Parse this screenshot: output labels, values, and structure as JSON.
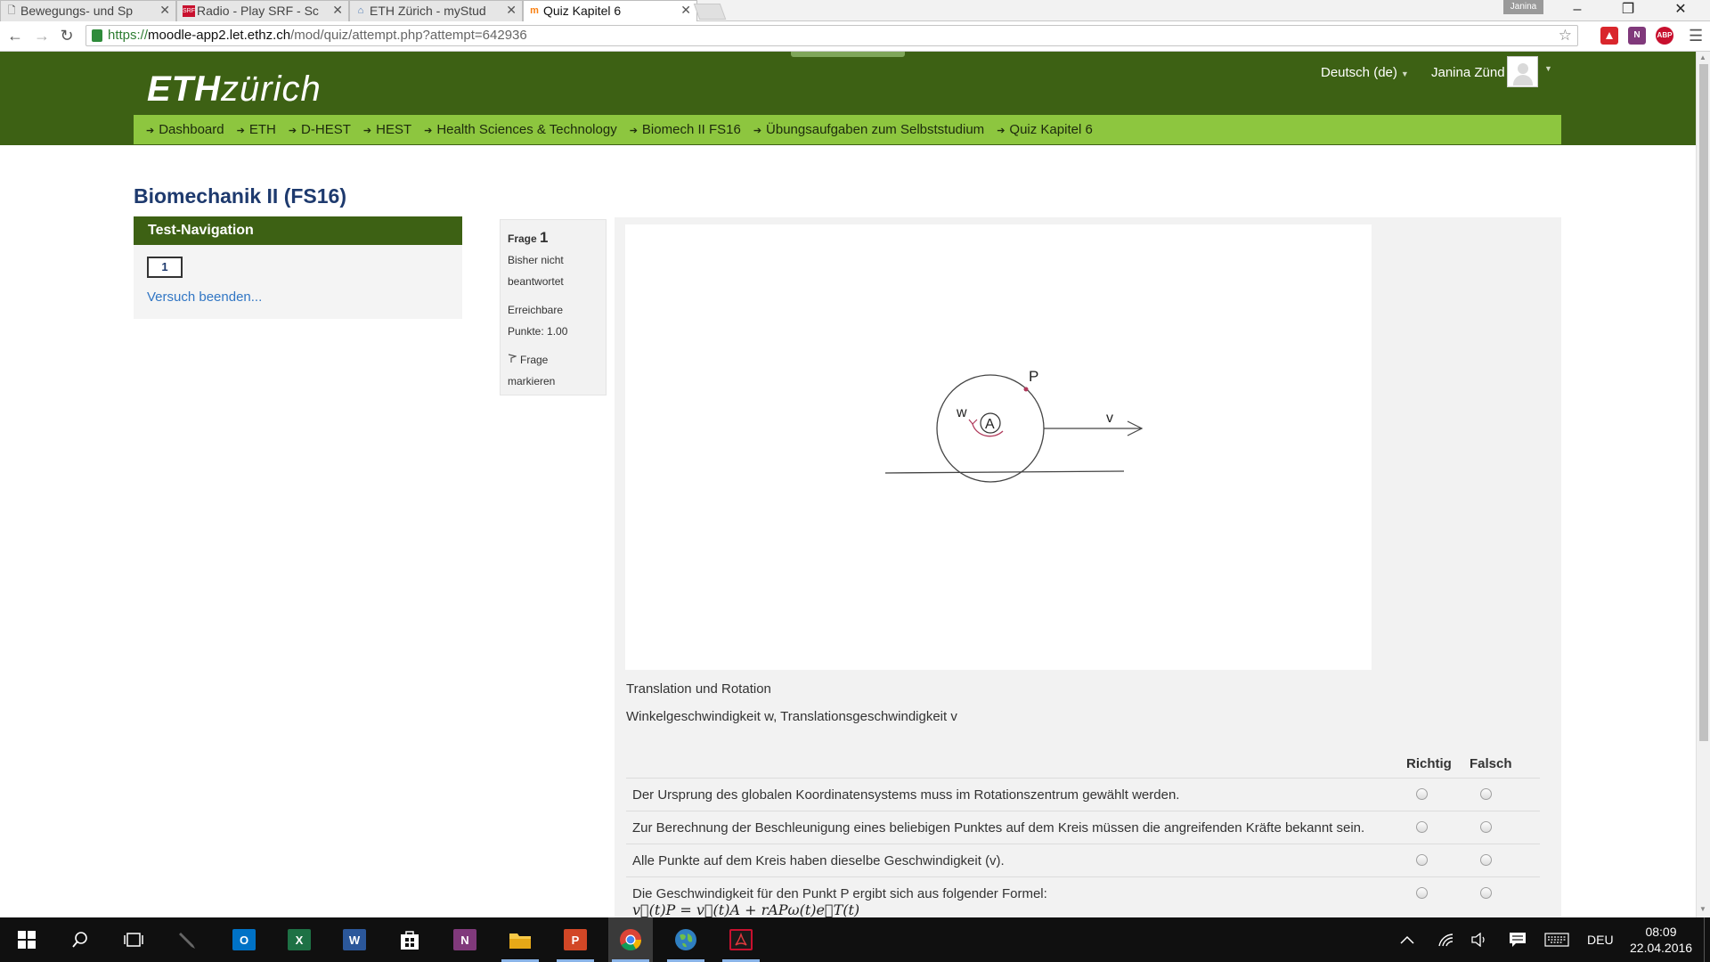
{
  "browser": {
    "tabs": [
      {
        "title": "Bewegungs- und Sp",
        "icon": "document-icon",
        "active": false
      },
      {
        "title": "Radio - Play SRF - Sc",
        "icon": "srf-icon",
        "active": false
      },
      {
        "title": "ETH Zürich - myStud",
        "icon": "house-icon",
        "active": false
      },
      {
        "title": "Quiz Kapitel 6",
        "icon": "moodle-icon",
        "active": true
      }
    ],
    "profile_name": "Janina",
    "url_scheme": "https://",
    "url_host": "moodle-app2.let.ethz.ch",
    "url_path": "/mod/quiz/attempt.php?attempt=642936",
    "extensions": [
      {
        "label": "",
        "color": "#d9262c"
      },
      {
        "label": "N",
        "color": "#80397b"
      },
      {
        "label": "ABP",
        "color": "#c8102e"
      }
    ]
  },
  "site": {
    "logo_bold": "ETH",
    "logo_light": "zürich",
    "language": "Deutsch (de)",
    "user_name": "Janina Zünd",
    "header_color": "#3d6114",
    "breadcrumb_color": "#8dc63f",
    "breadcrumbs": [
      "Dashboard",
      "ETH",
      "D-HEST",
      "HEST",
      "Health Sciences & Technology",
      "Biomech II FS16",
      "Übungsaufgaben zum Selbststudium",
      "Quiz Kapitel 6"
    ]
  },
  "course_title": "Biomechanik II (FS16)",
  "quiz_nav": {
    "heading": "Test-Navigation",
    "question_buttons": [
      "1"
    ],
    "finish_link": "Versuch beenden..."
  },
  "question_info": {
    "label": "Frage",
    "number": "1",
    "state_line1": "Bisher nicht",
    "state_line2": "beantwortet",
    "points_line1": "Erreichbare",
    "points_line2": "Punkte: 1.00",
    "flag_line1": "Frage",
    "flag_line2": "markieren"
  },
  "figure": {
    "label_p": "P",
    "label_w": "w",
    "label_a": "A",
    "label_v": "v"
  },
  "question": {
    "text1": "Translation und Rotation",
    "text2": "Winkelgeschwindigkeit w, Translationsgeschwindigkeit v",
    "col_true": "Richtig",
    "col_false": "Falsch",
    "statements": [
      {
        "text": "Der Ursprung des globalen Koordinatensystems muss im Rotationszentrum gewählt werden.",
        "formula": ""
      },
      {
        "text": "Zur Berechnung der Beschleunigung eines beliebigen Punktes auf dem Kreis müssen die angreifenden Kräfte bekannt sein.",
        "formula": ""
      },
      {
        "text": "Alle Punkte auf dem Kreis haben dieselbe Geschwindigkeit (v).",
        "formula": ""
      },
      {
        "text": "Die Geschwindigkeit für den Punkt P ergibt sich aus folgender Formel:",
        "formula": "v⃗(t)P = v⃗(t)A + rAPω(t)e⃗T(t)"
      }
    ]
  },
  "taskbar": {
    "apps": [
      {
        "name": "start-icon"
      },
      {
        "name": "search-icon"
      },
      {
        "name": "task-view-icon"
      },
      {
        "name": "pen-icon"
      },
      {
        "name": "outlook-icon",
        "label": "O",
        "color": "#0072c6"
      },
      {
        "name": "excel-icon",
        "label": "X",
        "color": "#1e7145"
      },
      {
        "name": "word-icon",
        "label": "W",
        "color": "#2b579a"
      },
      {
        "name": "store-icon"
      },
      {
        "name": "onenote-icon",
        "label": "N",
        "color": "#80397b"
      },
      {
        "name": "explorer-icon"
      },
      {
        "name": "powerpoint-icon",
        "label": "P",
        "color": "#d24726"
      },
      {
        "name": "chrome-icon"
      },
      {
        "name": "globe-icon"
      },
      {
        "name": "acrobat-icon"
      }
    ],
    "language": "DEU",
    "time": "08:09",
    "date": "22.04.2016"
  }
}
